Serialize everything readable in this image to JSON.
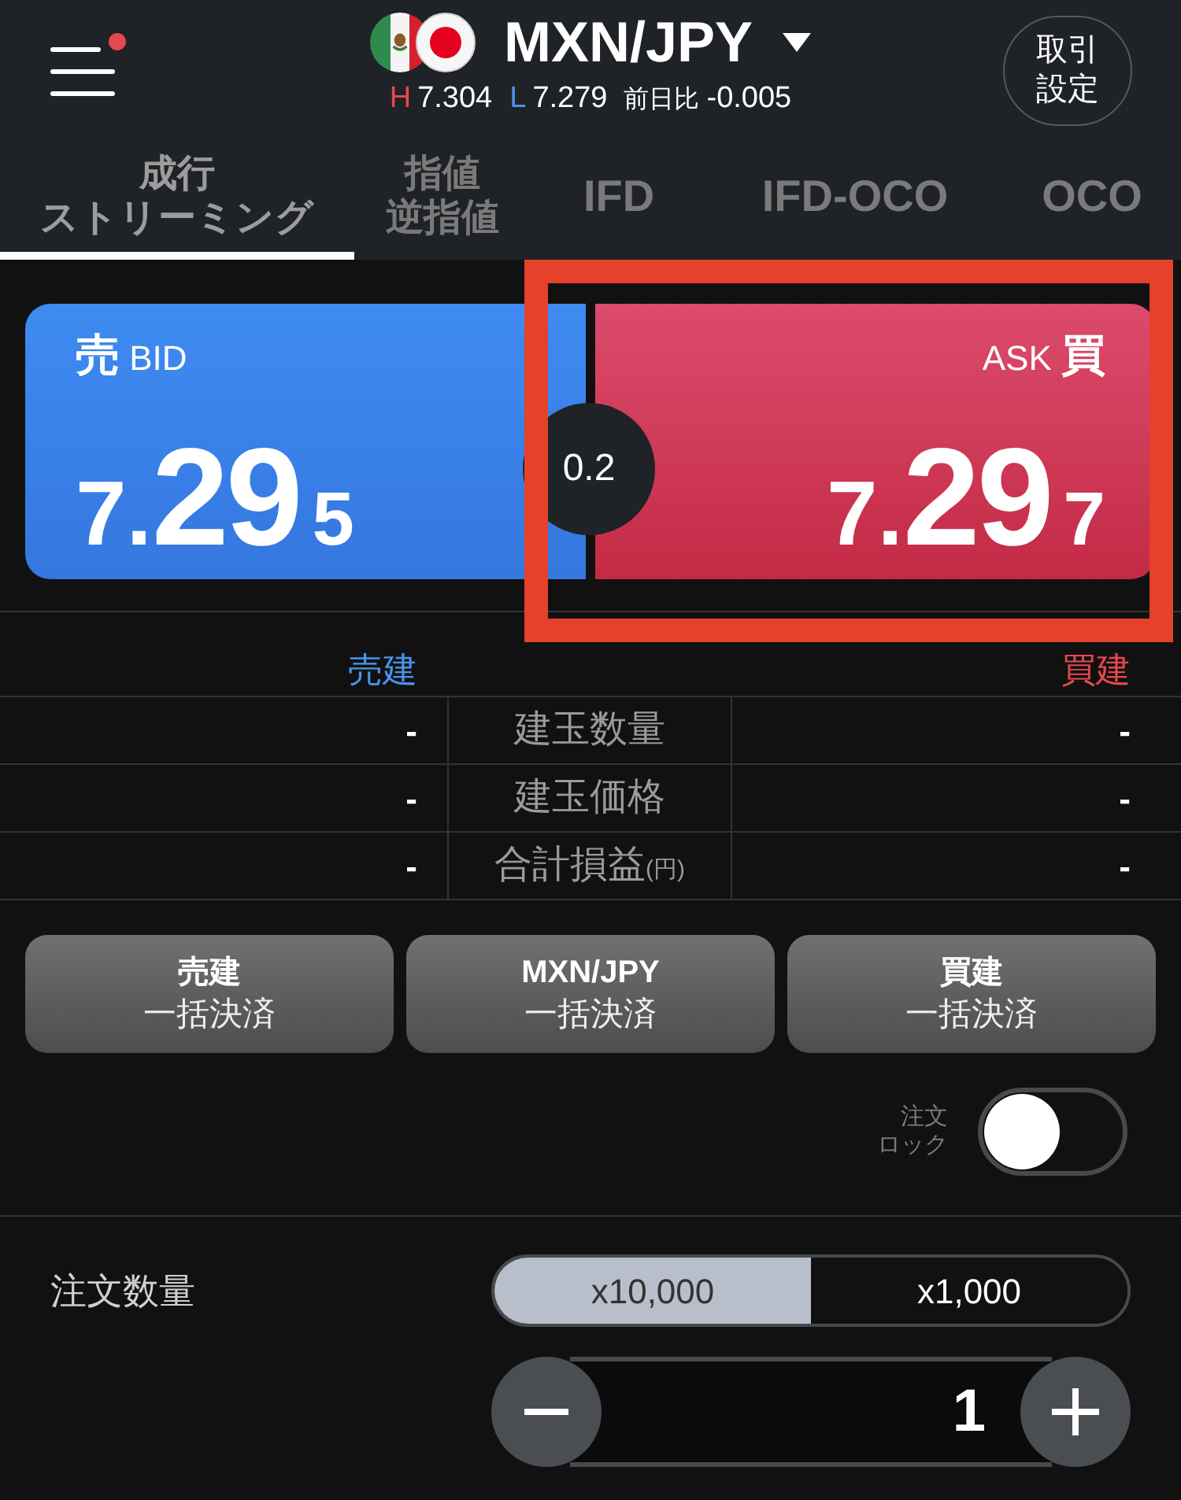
{
  "header": {
    "notification": true,
    "pair": "MXN/JPY",
    "stats": {
      "high_label": "H",
      "high": "7.304",
      "low_label": "L",
      "low": "7.279",
      "change_label": "前日比",
      "change": "-0.005"
    },
    "settings_button": [
      "取引",
      "設定"
    ]
  },
  "tabs": [
    {
      "lines": [
        "成行",
        "ストリーミング"
      ],
      "selected": true
    },
    {
      "lines": [
        "指値",
        "逆指値"
      ],
      "selected": false
    },
    {
      "lines": [
        "IFD"
      ],
      "selected": false
    },
    {
      "lines": [
        "IFD-OCO"
      ],
      "selected": false
    },
    {
      "lines": [
        "OCO"
      ],
      "selected": false
    }
  ],
  "quotes": [
    {
      "kind": "bid",
      "kanji": "売",
      "label": "BID",
      "price": {
        "lead": "7.",
        "main": "29",
        "tail": "5"
      },
      "highlighted": false
    },
    {
      "kind": "ask",
      "kanji": "買",
      "label": "ASK",
      "price": {
        "lead": "7.",
        "main": "29",
        "tail": "7"
      },
      "highlighted": true
    }
  ],
  "spread": "0.2",
  "positions": {
    "sell_header": "売建",
    "buy_header": "買建",
    "rows": [
      {
        "sell": "-",
        "label": "建玉数量",
        "buy": "-"
      },
      {
        "sell": "-",
        "label": "建玉価格",
        "buy": "-"
      },
      {
        "sell": "-",
        "label": "合計損益",
        "unit": "(円)",
        "buy": "-"
      }
    ]
  },
  "close_buttons": [
    {
      "lines": [
        "売建",
        "一括決済"
      ]
    },
    {
      "lines": [
        "MXN/JPY",
        "一括決済"
      ]
    },
    {
      "lines": [
        "買建",
        "一括決済"
      ]
    }
  ],
  "order_lock": {
    "label": [
      "注文",
      "ロック"
    ],
    "on": false
  },
  "quantity": {
    "label": "注文数量",
    "units": [
      {
        "label": "x10,000",
        "selected": true
      },
      {
        "label": "x1,000",
        "selected": false
      }
    ],
    "value": "1"
  }
}
